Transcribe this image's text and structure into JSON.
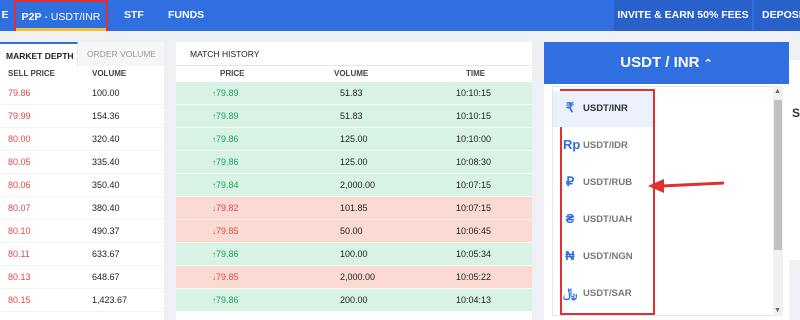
{
  "nav": {
    "edge": "E",
    "p2p": "P2P",
    "pair": " - USDT/INR",
    "stf": "STF",
    "funds": "FUNDS",
    "invite": "INVITE & EARN 50% FEES",
    "deposit": "DEPOSIT"
  },
  "depth": {
    "tab_active": "MARKET DEPTH",
    "tab_other": "ORDER VOLUME",
    "col_sell": "SELL PRICE",
    "col_volume": "VOLUME",
    "rows": [
      {
        "price": "79.86",
        "volume": "100.00"
      },
      {
        "price": "79.99",
        "volume": "154.36"
      },
      {
        "price": "80.00",
        "volume": "320.40"
      },
      {
        "price": "80.05",
        "volume": "335.40"
      },
      {
        "price": "80.06",
        "volume": "350.40"
      },
      {
        "price": "80.07",
        "volume": "380.40"
      },
      {
        "price": "80.10",
        "volume": "490.37"
      },
      {
        "price": "80.11",
        "volume": "633.67"
      },
      {
        "price": "80.13",
        "volume": "648.67"
      },
      {
        "price": "80.15",
        "volume": "1,423.67"
      }
    ]
  },
  "match": {
    "title": "MATCH HISTORY",
    "col_price": "PRICE",
    "col_volume": "VOLUME",
    "col_time": "TIME",
    "up_arrow": "↑",
    "down_arrow": "↓",
    "rows": [
      {
        "price": "79.89",
        "volume": "51.83",
        "time": "10:10:15"
      },
      {
        "price": "79.89",
        "volume": "51.83",
        "time": "10:10:15"
      },
      {
        "price": "79.86",
        "volume": "125.00",
        "time": "10:10:00"
      },
      {
        "price": "79.86",
        "volume": "125.00",
        "time": "10:08:30"
      },
      {
        "price": "79.84",
        "volume": "2,000.00",
        "time": "10:07:15"
      },
      {
        "price": "79.82",
        "volume": "101.85",
        "time": "10:07:15"
      },
      {
        "price": "79.85",
        "volume": "50.00",
        "time": "10:06:45"
      },
      {
        "price": "79.86",
        "volume": "100.00",
        "time": "10:05:34"
      },
      {
        "price": "79.85",
        "volume": "2,000.00",
        "time": "10:05:22"
      },
      {
        "price": "79.86",
        "volume": "200.00",
        "time": "10:04:13"
      }
    ]
  },
  "selector": {
    "title": "USDT / INR",
    "chevron": "⌃",
    "items": [
      {
        "symbol": "₹",
        "label": "USDT/INR"
      },
      {
        "symbol": "Rp",
        "label": "USDT/IDR"
      },
      {
        "symbol": "₽",
        "label": "USDT/RUB"
      },
      {
        "symbol": "₴",
        "label": "USDT/UAH"
      },
      {
        "symbol": "₦",
        "label": "USDT/NGN"
      },
      {
        "symbol": "﷼",
        "label": "USDT/SAR"
      }
    ]
  },
  "peek": {
    "letter": "S"
  },
  "colors": {
    "accent": "#2f6fe0",
    "up": "#17a45a",
    "down": "#e04848",
    "annotation": "#e0312f"
  }
}
